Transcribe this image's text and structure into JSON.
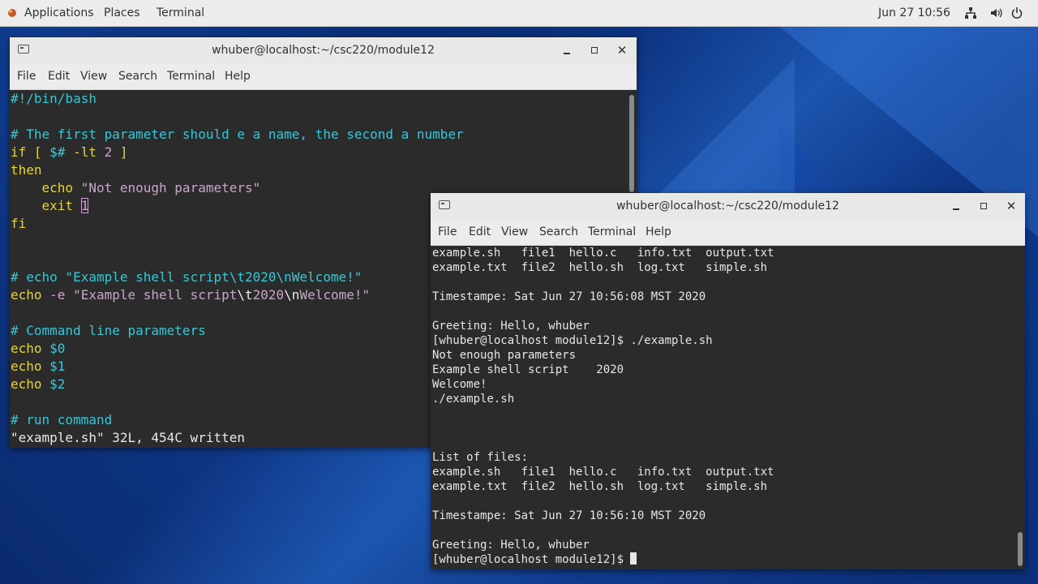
{
  "top_panel": {
    "applications": "Applications",
    "places": "Places",
    "terminal": "Terminal",
    "clock": "Jun 27  10:56",
    "icons": [
      "network-icon",
      "volume-icon",
      "power-icon"
    ]
  },
  "editor_window": {
    "title": "whuber@localhost:~/csc220/module12",
    "menu": [
      "File",
      "Edit",
      "View",
      "Search",
      "Terminal",
      "Help"
    ],
    "lines": [
      [
        {
          "t": "#!/bin/bash",
          "c": "com"
        }
      ],
      [],
      [
        {
          "t": "# The first parameter should e a name, the second a number",
          "c": "com"
        }
      ],
      [
        {
          "t": "if [ ",
          "c": "kw"
        },
        {
          "t": "$#",
          "c": "var"
        },
        {
          "t": " -lt ",
          "c": "kw"
        },
        {
          "t": "2",
          "c": "num"
        },
        {
          "t": " ]",
          "c": "kw"
        }
      ],
      [
        {
          "t": "then",
          "c": "kw"
        }
      ],
      [
        {
          "t": "    echo ",
          "c": "kw"
        },
        {
          "t": "\"Not enough parameters\"",
          "c": "str"
        }
      ],
      [
        {
          "t": "    exit ",
          "c": "kw"
        },
        {
          "t": "1",
          "c": "num",
          "box": true
        }
      ],
      [
        {
          "t": "fi",
          "c": "kw"
        }
      ],
      [],
      [],
      [
        {
          "t": "# echo \"Example shell script\\t2020\\nWelcome!\"",
          "c": "com"
        }
      ],
      [
        {
          "t": "echo ",
          "c": "kw"
        },
        {
          "t": "-e ",
          "c": "str"
        },
        {
          "t": "\"Example shell script",
          "c": "str"
        },
        {
          "t": "\\t",
          "c": "def"
        },
        {
          "t": "2020",
          "c": "str"
        },
        {
          "t": "\\n",
          "c": "def"
        },
        {
          "t": "Welcome!\"",
          "c": "str"
        }
      ],
      [],
      [
        {
          "t": "# Command line parameters",
          "c": "com"
        }
      ],
      [
        {
          "t": "echo ",
          "c": "kw"
        },
        {
          "t": "$0",
          "c": "var"
        }
      ],
      [
        {
          "t": "echo ",
          "c": "kw"
        },
        {
          "t": "$1",
          "c": "var"
        }
      ],
      [
        {
          "t": "echo ",
          "c": "kw"
        },
        {
          "t": "$2",
          "c": "var"
        }
      ],
      [],
      [
        {
          "t": "# run command",
          "c": "com"
        }
      ],
      [
        {
          "t": "\"example.sh\" 32L, 454C written",
          "c": "def"
        }
      ]
    ]
  },
  "output_window": {
    "title": "whuber@localhost:~/csc220/module12",
    "menu": [
      "File",
      "Edit",
      "View",
      "Search",
      "Terminal",
      "Help"
    ],
    "lines": [
      "example.sh   file1  hello.c   info.txt  output.txt",
      "example.txt  file2  hello.sh  log.txt   simple.sh",
      "",
      "Timestampe: Sat Jun 27 10:56:08 MST 2020",
      "",
      "Greeting: Hello, whuber",
      "[whuber@localhost module12]$ ./example.sh",
      "Not enough parameters",
      "Example shell script    2020",
      "Welcome!",
      "./example.sh",
      "",
      "",
      "",
      "List of files:",
      "example.sh   file1  hello.c   info.txt  output.txt",
      "example.txt  file2  hello.sh  log.txt   simple.sh",
      "",
      "Timestampe: Sat Jun 27 10:56:10 MST 2020",
      "",
      "Greeting: Hello, whuber"
    ],
    "prompt": "[whuber@localhost module12]$ "
  }
}
